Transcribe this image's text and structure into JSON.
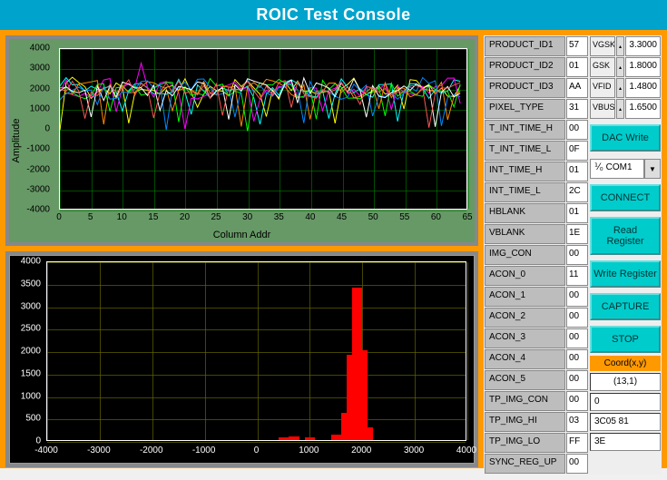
{
  "title": "ROIC Test Console",
  "registers": [
    {
      "name": "PRODUCT_ID1",
      "val": "57"
    },
    {
      "name": "PRODUCT_ID2",
      "val": "01"
    },
    {
      "name": "PRODUCT_ID3",
      "val": "AA"
    },
    {
      "name": "PIXEL_TYPE",
      "val": "31"
    },
    {
      "name": "T_INT_TIME_H",
      "val": "00"
    },
    {
      "name": "T_INT_TIME_L",
      "val": "0F"
    },
    {
      "name": "INT_TIME_H",
      "val": "01"
    },
    {
      "name": "INT_TIME_L",
      "val": "2C"
    },
    {
      "name": "HBLANK",
      "val": "01"
    },
    {
      "name": "VBLANK",
      "val": "1E"
    },
    {
      "name": "IMG_CON",
      "val": "00"
    },
    {
      "name": "ACON_0",
      "val": "11"
    },
    {
      "name": "ACON_1",
      "val": "00"
    },
    {
      "name": "ACON_2",
      "val": "00"
    },
    {
      "name": "ACON_3",
      "val": "00"
    },
    {
      "name": "ACON_4",
      "val": "00"
    },
    {
      "name": "ACON_5",
      "val": "00"
    },
    {
      "name": "TP_IMG_CON",
      "val": "00"
    },
    {
      "name": "TP_IMG_HI",
      "val": "03"
    },
    {
      "name": "TP_IMG_LO",
      "val": "FF"
    },
    {
      "name": "SYNC_REG_UP",
      "val": "00"
    }
  ],
  "voltages": [
    {
      "name": "VGSK",
      "val": "3.3000"
    },
    {
      "name": "GSK",
      "val": "1.8000"
    },
    {
      "name": "VFID",
      "val": "1.4800"
    },
    {
      "name": "VBUS",
      "val": "1.6500"
    }
  ],
  "buttons": {
    "dac": "DAC Write",
    "connect": "CONNECT",
    "read": "Read Register",
    "write": "Write Register",
    "capture": "CAPTURE",
    "stop": "STOP"
  },
  "com_port": "COM1",
  "coord_label": "Coord(x,y)",
  "coord_val": "(13,1)",
  "field1": "0",
  "field2": "3C05 81",
  "field3": "3E",
  "chart_data": [
    {
      "type": "line",
      "title": "",
      "xlabel": "Column Addr",
      "ylabel": "Amplitude",
      "xlim": [
        0,
        65
      ],
      "ylim": [
        -4000,
        4000
      ],
      "xticks": [
        0,
        5,
        10,
        15,
        20,
        25,
        30,
        35,
        40,
        45,
        50,
        55,
        60,
        65
      ],
      "yticks": [
        -4000,
        -3000,
        -2000,
        -1000,
        0,
        1000,
        2000,
        3000,
        4000
      ],
      "series_count": 8,
      "series_mean": 2000,
      "series_range": [
        500,
        2800
      ]
    },
    {
      "type": "bar",
      "title": "",
      "xlabel": "",
      "ylabel": "",
      "xlim": [
        -4000,
        4000
      ],
      "ylim": [
        0,
        4000
      ],
      "xticks": [
        -4000,
        -3000,
        -2000,
        -1000,
        0,
        1000,
        2000,
        3000,
        4000
      ],
      "yticks": [
        0,
        500,
        1000,
        1500,
        2000,
        2500,
        3000,
        3500,
        4000
      ],
      "histogram": [
        {
          "x": 500,
          "y": 60
        },
        {
          "x": 700,
          "y": 90
        },
        {
          "x": 1000,
          "y": 60
        },
        {
          "x": 1500,
          "y": 120
        },
        {
          "x": 1700,
          "y": 600
        },
        {
          "x": 1800,
          "y": 1900
        },
        {
          "x": 1900,
          "y": 3400
        },
        {
          "x": 2000,
          "y": 2000
        },
        {
          "x": 2100,
          "y": 280
        }
      ]
    }
  ]
}
